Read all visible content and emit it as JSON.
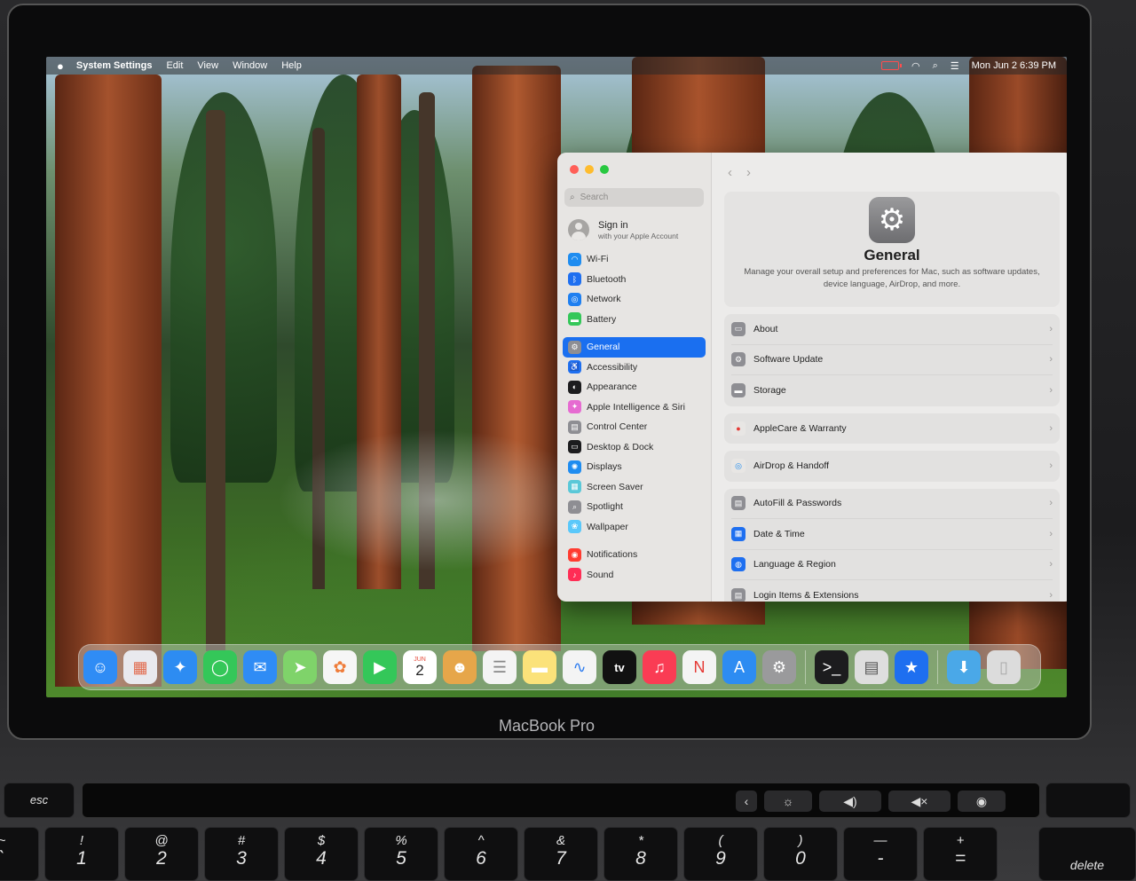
{
  "menubar": {
    "app": "System Settings",
    "items": [
      "Edit",
      "View",
      "Window",
      "Help"
    ],
    "clock": "Mon Jun 2  6:39 PM"
  },
  "sidebar": {
    "search_placeholder": "Search",
    "signin_title": "Sign in",
    "signin_subtitle": "with your Apple Account",
    "groups": [
      [
        {
          "label": "Wi-Fi",
          "icon": "wifi-icon",
          "color": "#1e8cf0",
          "glyph": "◠"
        },
        {
          "label": "Bluetooth",
          "icon": "bluetooth-icon",
          "color": "#1e6ff0",
          "glyph": "ᛒ"
        },
        {
          "label": "Network",
          "icon": "network-icon",
          "color": "#1e7ff0",
          "glyph": "◎"
        },
        {
          "label": "Battery",
          "icon": "battery-icon",
          "color": "#34c759",
          "glyph": "▬"
        }
      ],
      [
        {
          "label": "General",
          "icon": "gear-icon",
          "color": "#8e8e93",
          "glyph": "⚙",
          "active": true
        },
        {
          "label": "Accessibility",
          "icon": "accessibility-icon",
          "color": "#1e6ff0",
          "glyph": "♿"
        },
        {
          "label": "Appearance",
          "icon": "appearance-icon",
          "color": "#1c1c1e",
          "glyph": "◐"
        },
        {
          "label": "Apple Intelligence & Siri",
          "icon": "siri-icon",
          "color": "#e66bd1",
          "glyph": "✦"
        },
        {
          "label": "Control Center",
          "icon": "control-center-icon",
          "color": "#8e8e93",
          "glyph": "▤"
        },
        {
          "label": "Desktop & Dock",
          "icon": "desktop-icon",
          "color": "#1c1c1e",
          "glyph": "▭"
        },
        {
          "label": "Displays",
          "icon": "displays-icon",
          "color": "#1e8cf0",
          "glyph": "✺"
        },
        {
          "label": "Screen Saver",
          "icon": "screen-saver-icon",
          "color": "#5ac8d8",
          "glyph": "▦"
        },
        {
          "label": "Spotlight",
          "icon": "spotlight-icon",
          "color": "#8e8e93",
          "glyph": "⌕"
        },
        {
          "label": "Wallpaper",
          "icon": "wallpaper-icon",
          "color": "#5ac8fa",
          "glyph": "❀"
        }
      ],
      [
        {
          "label": "Notifications",
          "icon": "notifications-icon",
          "color": "#ff3b30",
          "glyph": "◉"
        },
        {
          "label": "Sound",
          "icon": "sound-icon",
          "color": "#ff2d55",
          "glyph": "♪"
        }
      ]
    ]
  },
  "content": {
    "title": "General",
    "description": "Manage your overall setup and preferences for Mac, such as software updates, device language, AirDrop, and more.",
    "cards": [
      [
        {
          "label": "About",
          "icon": "about-icon",
          "color": "#8e8e93",
          "glyph": "▭"
        },
        {
          "label": "Software Update",
          "icon": "software-update-icon",
          "color": "#8e8e93",
          "glyph": "⚙"
        },
        {
          "label": "Storage",
          "icon": "storage-icon",
          "color": "#8e8e93",
          "glyph": "▬"
        }
      ],
      [
        {
          "label": "AppleCare & Warranty",
          "icon": "applecare-icon",
          "color": "#e8e6e4",
          "glyph": "",
          "fg": "#e53935"
        }
      ],
      [
        {
          "label": "AirDrop & Handoff",
          "icon": "airdrop-icon",
          "color": "#e8e6e4",
          "glyph": "◎",
          "fg": "#1e8cf0"
        }
      ],
      [
        {
          "label": "AutoFill & Passwords",
          "icon": "autofill-icon",
          "color": "#8e8e93",
          "glyph": "▤"
        },
        {
          "label": "Date & Time",
          "icon": "date-time-icon",
          "color": "#1e6ff0",
          "glyph": "▦"
        },
        {
          "label": "Language & Region",
          "icon": "language-icon",
          "color": "#1e6ff0",
          "glyph": "◍"
        },
        {
          "label": "Login Items & Extensions",
          "icon": "login-items-icon",
          "color": "#8e8e93",
          "glyph": "▤"
        }
      ]
    ]
  },
  "dock": {
    "calendar_month": "JUN",
    "calendar_day": "2",
    "tv_label": "tv",
    "apps": [
      {
        "name": "finder-icon",
        "color": "#2f8cf5",
        "glyph": "☺"
      },
      {
        "name": "launchpad-icon",
        "color": "#e9e9ee",
        "glyph": "▦",
        "fg": "#e26a4d"
      },
      {
        "name": "safari-icon",
        "color": "#2d8cf2",
        "glyph": "✦"
      },
      {
        "name": "messages-icon",
        "color": "#34c759",
        "glyph": "◯"
      },
      {
        "name": "mail-icon",
        "color": "#2f8cf5",
        "glyph": "✉"
      },
      {
        "name": "maps-icon",
        "color": "#7fd36a",
        "glyph": "➤"
      },
      {
        "name": "photos-icon",
        "color": "#f6f6f6",
        "glyph": "✿",
        "fg": "#ef7d3b"
      },
      {
        "name": "facetime-icon",
        "color": "#34c759",
        "glyph": "▶"
      },
      {
        "name": "calendar-icon",
        "color": "#ffffff",
        "glyph": "cal"
      },
      {
        "name": "contacts-icon",
        "color": "#e6a64a",
        "glyph": "☻"
      },
      {
        "name": "reminders-icon",
        "color": "#f4f4f4",
        "glyph": "☰",
        "fg": "#888"
      },
      {
        "name": "notes-icon",
        "color": "#fbe27a",
        "glyph": "▬",
        "fg": "#fff"
      },
      {
        "name": "freeform-icon",
        "color": "#f4f4f4",
        "glyph": "∿",
        "fg": "#2d7cf0"
      },
      {
        "name": "apple-tv-icon",
        "color": "#111111",
        "glyph": "tv"
      },
      {
        "name": "music-icon",
        "color": "#fa3c54",
        "glyph": "♫"
      },
      {
        "name": "news-icon",
        "color": "#f4f4f4",
        "glyph": "N",
        "fg": "#e53935"
      },
      {
        "name": "app-store-icon",
        "color": "#2d8cf2",
        "glyph": "A"
      },
      {
        "name": "system-settings-icon",
        "color": "#9a9a9c",
        "glyph": "⚙"
      },
      {
        "name": "separator"
      },
      {
        "name": "terminal-icon",
        "color": "#1c1c1e",
        "glyph": ">_"
      },
      {
        "name": "printer-icon",
        "color": "#dedede",
        "glyph": "▤",
        "fg": "#555"
      },
      {
        "name": "app-icon",
        "color": "#1e6ff0",
        "glyph": "★"
      },
      {
        "name": "separator"
      },
      {
        "name": "downloads-icon",
        "color": "#4aa8e8",
        "glyph": "⬇"
      },
      {
        "name": "trash-icon",
        "color": "#dcdcdc",
        "glyph": "▯",
        "fg": "#aaa"
      }
    ]
  },
  "laptop": {
    "brand": "MacBook Pro",
    "esc": "esc",
    "delete": "delete",
    "keys": [
      {
        "top": "~",
        "bot": "`"
      },
      {
        "top": "!",
        "bot": "1"
      },
      {
        "top": "@",
        "bot": "2"
      },
      {
        "top": "#",
        "bot": "3"
      },
      {
        "top": "$",
        "bot": "4"
      },
      {
        "top": "%",
        "bot": "5"
      },
      {
        "top": "^",
        "bot": "6"
      },
      {
        "top": "&",
        "bot": "7"
      },
      {
        "top": "*",
        "bot": "8"
      },
      {
        "top": "(",
        "bot": "9"
      },
      {
        "top": ")",
        "bot": "0"
      },
      {
        "top": "—",
        "bot": "-"
      },
      {
        "top": "+",
        "bot": "="
      }
    ]
  }
}
